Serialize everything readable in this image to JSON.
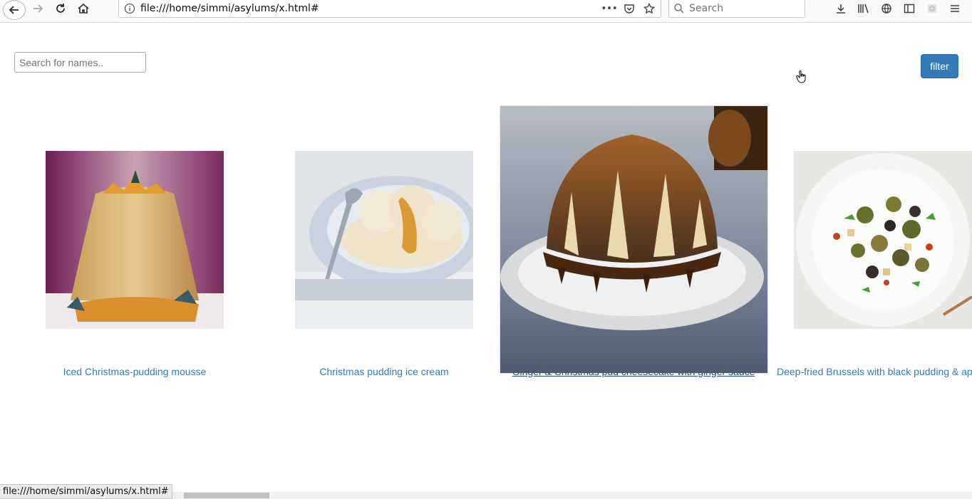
{
  "browser": {
    "url": "file:///home/simmi/asylums/x.html#",
    "search_placeholder": "Search",
    "more_label": "•••"
  },
  "page": {
    "search_placeholder": "Search for names..",
    "filter_label": "filter",
    "items": [
      {
        "title": "Iced Christmas-pudding mousse"
      },
      {
        "title": "Christmas pudding ice cream"
      },
      {
        "title": "Ginger & Christmas pud cheesecake with ginger sauce"
      },
      {
        "title": "Deep-fried Brussels with black pudding & ap"
      }
    ]
  },
  "status": {
    "text": "file:///home/simmi/asylums/x.html#"
  },
  "colors": {
    "link": "#337ab7",
    "link_hover": "#23527c",
    "button": "#337ab7"
  }
}
